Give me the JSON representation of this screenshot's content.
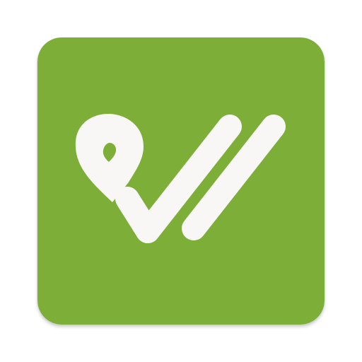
{
  "app_icon": {
    "icon_name": "map-pin-checkmark-logo-icon",
    "colors": {
      "background": "#7DAF38",
      "foreground": "#F8F7F5",
      "pin_hole": "#7DAF38"
    }
  }
}
